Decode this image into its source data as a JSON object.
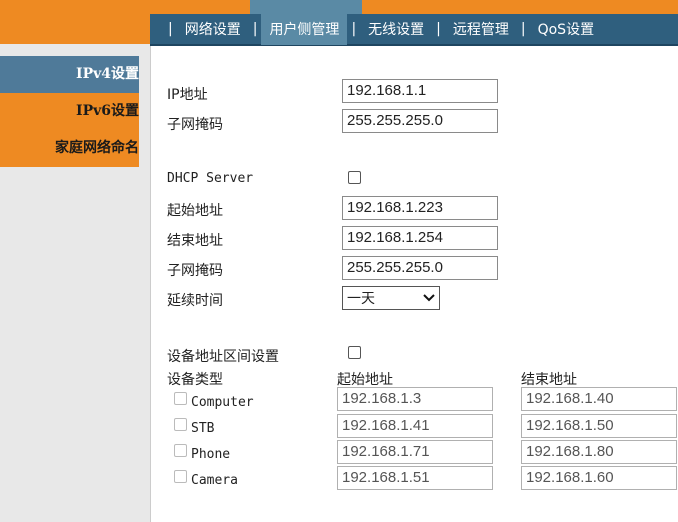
{
  "nav": {
    "items": [
      "网络设置",
      "用户侧管理",
      "无线设置",
      "远程管理",
      "QoS设置"
    ],
    "active_index": 1
  },
  "sidebar": {
    "items": [
      "IPv4设置",
      "IPv6设置",
      "家庭网络命名"
    ],
    "active_index": 0
  },
  "lan": {
    "ip_label": "IP地址",
    "ip_value": "192.168.1.1",
    "mask_label": "子网掩码",
    "mask_value": "255.255.255.0"
  },
  "dhcp": {
    "server_label": "DHCP Server",
    "start_label": "起始地址",
    "start_value": "192.168.1.223",
    "end_label": "结束地址",
    "end_value": "192.168.1.254",
    "mask_label": "子网掩码",
    "mask_value": "255.255.255.0",
    "lease_label": "延续时间",
    "lease_value": "一天"
  },
  "range": {
    "section_label": "设备地址区间设置",
    "type_header": "设备类型",
    "start_header": "起始地址",
    "end_header": "结束地址",
    "rows": [
      {
        "type": "Computer",
        "start": "192.168.1.3",
        "end": "192.168.1.40"
      },
      {
        "type": "STB",
        "start": "192.168.1.41",
        "end": "192.168.1.50"
      },
      {
        "type": "Phone",
        "start": "192.168.1.71",
        "end": "192.168.1.80"
      },
      {
        "type": "Camera",
        "start": "192.168.1.51",
        "end": "192.168.1.60"
      }
    ]
  },
  "colors": {
    "orange": "#ee8a22",
    "nav_blue": "#2f5f7e",
    "active_blue": "#4f7a99"
  }
}
